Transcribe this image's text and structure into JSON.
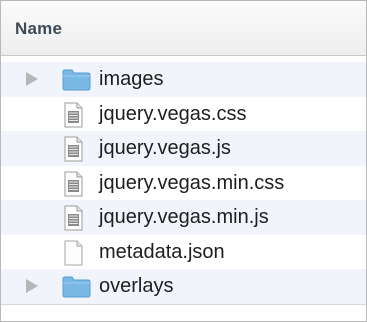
{
  "header": {
    "column_name": "Name"
  },
  "files": [
    {
      "name": "images",
      "kind": "folder",
      "expandable": true,
      "icon": "folder-icon"
    },
    {
      "name": "jquery.vegas.css",
      "kind": "file",
      "expandable": false,
      "icon": "document-icon"
    },
    {
      "name": "jquery.vegas.js",
      "kind": "file",
      "expandable": false,
      "icon": "document-icon"
    },
    {
      "name": "jquery.vegas.min.css",
      "kind": "file",
      "expandable": false,
      "icon": "document-icon"
    },
    {
      "name": "jquery.vegas.min.js",
      "kind": "file",
      "expandable": false,
      "icon": "document-icon"
    },
    {
      "name": "metadata.json",
      "kind": "file",
      "expandable": false,
      "icon": "blank-document-icon"
    },
    {
      "name": "overlays",
      "kind": "folder",
      "expandable": true,
      "icon": "folder-icon"
    }
  ],
  "colors": {
    "row_alt": "#f1f5fb",
    "folder": "#7ab8e6",
    "header_text": "#3d4a57"
  }
}
